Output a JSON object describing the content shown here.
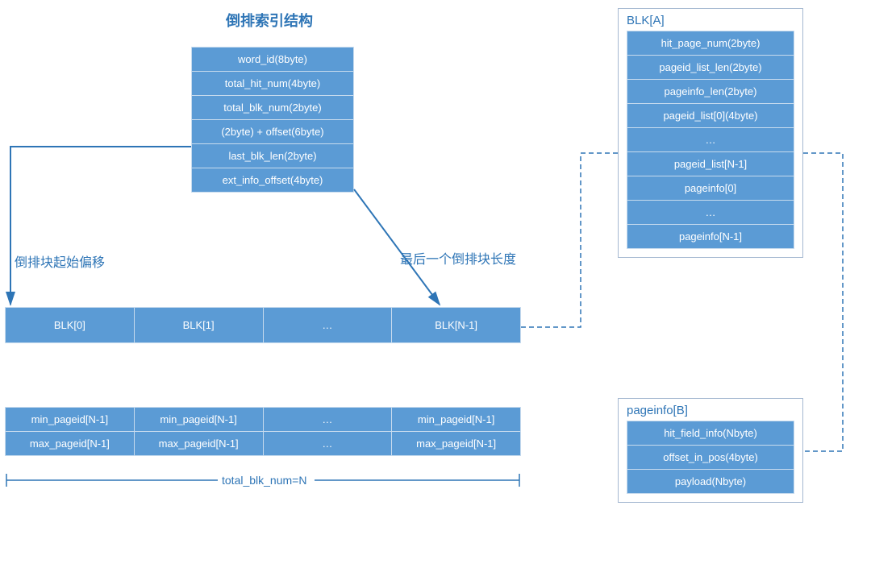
{
  "titles": {
    "main": "倒排索引结构",
    "blk_detail": "BLK[A]",
    "pageinfo_detail": "pageinfo[B]"
  },
  "index_struct": [
    "word_id(8byte)",
    "total_hit_num(4byte)",
    "total_blk_num(2byte)",
    "(2byte) + offset(6byte)",
    "last_blk_len(2byte)",
    "ext_info_offset(4byte)"
  ],
  "labels": {
    "start_offset": "倒排块起始偏移",
    "last_len": "最后一个倒排块长度",
    "total_blk": "total_blk_num=N"
  },
  "blk_row": [
    "BLK[0]",
    "BLK[1]",
    "…",
    "BLK[N-1]"
  ],
  "pageid_rows": {
    "min": [
      "min_pageid[N-1]",
      "min_pageid[N-1]",
      "…",
      "min_pageid[N-1]"
    ],
    "max": [
      "max_pageid[N-1]",
      "max_pageid[N-1]",
      "…",
      "max_pageid[N-1]"
    ]
  },
  "blk_detail": [
    "hit_page_num(2byte)",
    "pageid_list_len(2byte)",
    "pageinfo_len(2byte)",
    "pageid_list[0](4byte)",
    "…",
    "pageid_list[N-1]",
    "pageinfo[0]",
    "…",
    "pageinfo[N-1]"
  ],
  "pageinfo_detail": [
    "hit_field_info(Nbyte)",
    "offset_in_pos(4byte)",
    "payload(Nbyte)"
  ]
}
